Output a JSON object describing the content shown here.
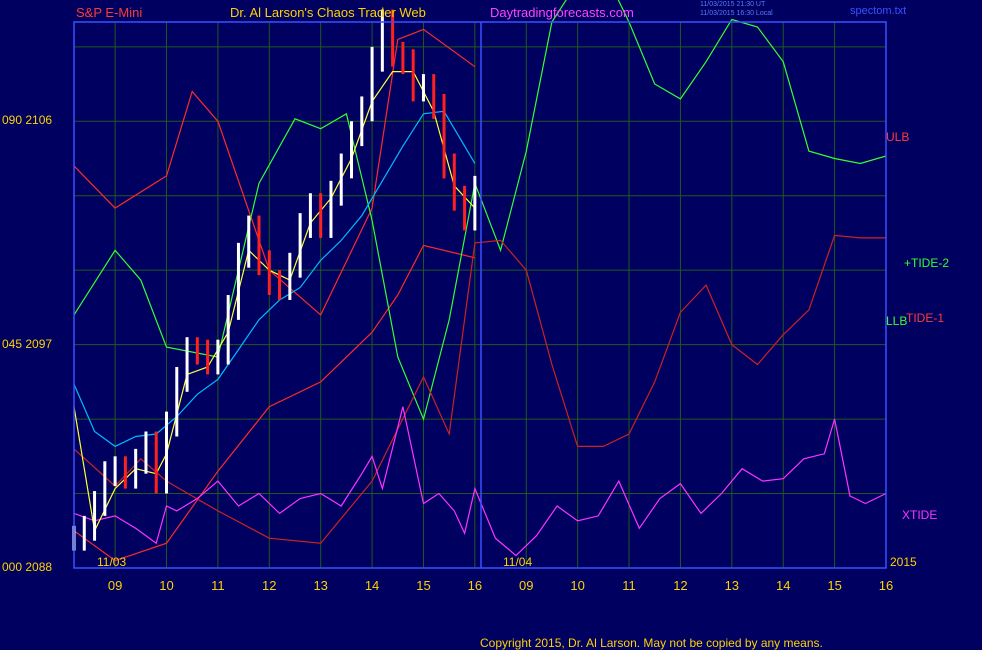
{
  "header": {
    "instrument": "S&P E-Mini",
    "title": "Dr. Al Larson's Chaos Trader Web",
    "site": "Daytradingforecasts.com",
    "stamp_utc": "11/03/2015 21:30 UT",
    "stamp_local": "11/03/2015 16:30 Local",
    "file": "spectom.txt"
  },
  "colors": {
    "background": "#000060",
    "frame": "#3a50ff",
    "grid": "#1e5a1e",
    "price_up": "#ffffff",
    "price_down": "#ff2020",
    "ulb_llb": "#ff2a2a",
    "tide2": "#33ff33",
    "tide1": "#cc2222",
    "xtide": "#ff33ff",
    "ma_fast": "#ffff33",
    "ma_slow": "#00bbff",
    "labels": "#ffd200"
  },
  "footer": {
    "copyright": "Copyright 2015, Dr. Al Larson. May not be copied by any means."
  },
  "chart_data": {
    "type": "line",
    "title": "S&P E-Mini",
    "ylim": [
      2088,
      2110
    ],
    "y_ticks": [
      {
        "left": "090",
        "value": 2106
      },
      {
        "left": "045",
        "value": 2097
      },
      {
        "left": "000",
        "value": 2088
      }
    ],
    "x_range_hours": [
      8.2,
      24
    ],
    "x_ticks": [
      {
        "label": "09",
        "hour": 9
      },
      {
        "label": "10",
        "hour": 10
      },
      {
        "label": "11",
        "hour": 11
      },
      {
        "label": "12",
        "hour": 12
      },
      {
        "label": "13",
        "hour": 13
      },
      {
        "label": "14",
        "hour": 14
      },
      {
        "label": "15",
        "hour": 15
      },
      {
        "label": "16",
        "hour": 16
      },
      {
        "label": "09",
        "hour": 17
      },
      {
        "label": "10",
        "hour": 18
      },
      {
        "label": "11",
        "hour": 19
      },
      {
        "label": "12",
        "hour": 20
      },
      {
        "label": "13",
        "hour": 21
      },
      {
        "label": "14",
        "hour": 22
      },
      {
        "label": "15",
        "hour": 23
      },
      {
        "label": "16",
        "hour": 24
      }
    ],
    "date_labels": [
      "11/03",
      "11/04"
    ],
    "date_divider_hour": 16,
    "year_label": "2015",
    "line_labels": {
      "ulb": "ULB",
      "tide2": "+TIDE-2",
      "llb": "LLB",
      "tide1": "TIDE-1",
      "xtide": "XTIDE"
    },
    "price": {
      "name": "S&P E-Mini",
      "hours": [
        8.2,
        8.4,
        8.6,
        8.8,
        9.0,
        9.2,
        9.4,
        9.6,
        9.8,
        10.0,
        10.2,
        10.4,
        10.6,
        10.8,
        11.0,
        11.2,
        11.4,
        11.6,
        11.8,
        12.0,
        12.2,
        12.4,
        12.6,
        12.8,
        13.0,
        13.2,
        13.4,
        13.6,
        13.8,
        14.0,
        14.2,
        14.4,
        14.6,
        14.8,
        15.0,
        15.2,
        15.4,
        15.6,
        15.8,
        16.0
      ],
      "values": [
        2089.2,
        2089.6,
        2090.6,
        2091.8,
        2092.0,
        2091.7,
        2092.3,
        2093.0,
        2091.5,
        2093.8,
        2095.6,
        2096.8,
        2096.7,
        2096.3,
        2096.7,
        2098.5,
        2100.6,
        2101.7,
        2100.3,
        2099.5,
        2099.3,
        2100.2,
        2101.8,
        2102.6,
        2101.8,
        2103.1,
        2104.2,
        2105.5,
        2106.5,
        2108.5,
        2110.0,
        2108.7,
        2108.4,
        2107.3,
        2107.4,
        2106.6,
        2104.2,
        2102.9,
        2102.1,
        2103.3
      ]
    },
    "series": [
      {
        "name": "ULB",
        "hours": [
          8.2,
          9.0,
          10.0,
          10.5,
          11.0,
          12.0,
          13.0,
          14.0,
          14.5,
          15.0,
          16.0
        ],
        "values": [
          2104.2,
          2102.5,
          2103.8,
          2107.2,
          2106.0,
          2100.0,
          2098.2,
          2102.5,
          2109.3,
          2109.7,
          2108.2
        ]
      },
      {
        "name": "LLB",
        "hours": [
          8.2,
          9.0,
          10.0,
          11.0,
          12.0,
          13.0,
          14.0,
          14.5,
          15.0,
          16.0
        ],
        "values": [
          2089.5,
          2088.3,
          2089.0,
          2091.9,
          2094.5,
          2095.5,
          2097.5,
          2099.0,
          2101.0,
          2100.5
        ]
      },
      {
        "name": "+TIDE-2",
        "hours": [
          8.2,
          9.0,
          9.5,
          10.0,
          11.0,
          11.8,
          12.5,
          13.0,
          13.5,
          14.0,
          14.5,
          15.0,
          15.5,
          16.0,
          16.5,
          17.0,
          17.5,
          18.0,
          18.6,
          19.0,
          19.5,
          20.0,
          20.5,
          21.0,
          21.5,
          22.0,
          22.5,
          23.0,
          23.5,
          24.0
        ],
        "values": [
          2098.2,
          2100.8,
          2099.6,
          2096.9,
          2096.5,
          2103.5,
          2106.1,
          2105.7,
          2106.3,
          2102.0,
          2096.5,
          2094.0,
          2098.0,
          2103.5,
          2100.8,
          2104.8,
          2110.0,
          2111.6,
          2111.7,
          2110.0,
          2107.5,
          2106.9,
          2108.4,
          2110.1,
          2109.8,
          2108.4,
          2104.8,
          2104.5,
          2104.3,
          2104.6
        ]
      },
      {
        "name": "TIDE-1",
        "hours": [
          8.2,
          9.0,
          9.5,
          10.0,
          11.0,
          12.0,
          13.0,
          14.0,
          14.5,
          15.0,
          15.5,
          16.0,
          16.5,
          17.0,
          17.5,
          18.0,
          18.5,
          19.0,
          19.5,
          20.0,
          20.5,
          21.0,
          21.5,
          22.0,
          22.5,
          23.0,
          23.5,
          24.0
        ],
        "values": [
          2092.8,
          2091.3,
          2092.4,
          2091.5,
          2090.3,
          2089.2,
          2089.0,
          2091.5,
          2093.6,
          2095.7,
          2093.4,
          2101.1,
          2101.2,
          2100.0,
          2096.2,
          2092.9,
          2092.9,
          2093.4,
          2095.5,
          2098.3,
          2099.4,
          2097.0,
          2096.2,
          2097.4,
          2098.4,
          2101.4,
          2101.3,
          2101.3
        ]
      },
      {
        "name": "XTIDE",
        "hours": [
          8.2,
          8.6,
          9.0,
          9.4,
          9.8,
          10.0,
          10.2,
          10.6,
          11.0,
          11.4,
          11.8,
          12.2,
          12.6,
          13.0,
          13.4,
          13.8,
          14.0,
          14.2,
          14.6,
          15.0,
          15.3,
          15.6,
          15.8,
          16.0,
          16.4,
          16.8,
          17.2,
          17.6,
          18.0,
          18.4,
          18.8,
          19.2,
          19.6,
          20.0,
          20.4,
          20.8,
          21.2,
          21.6,
          22.0,
          22.4,
          22.8,
          23.0,
          23.3,
          23.6,
          24.0
        ],
        "values": [
          2090.2,
          2089.9,
          2090.1,
          2089.6,
          2089.0,
          2090.5,
          2090.3,
          2090.8,
          2091.5,
          2090.5,
          2091.0,
          2090.2,
          2090.8,
          2091.0,
          2090.5,
          2091.8,
          2092.5,
          2091.2,
          2094.5,
          2090.6,
          2091.0,
          2090.3,
          2089.4,
          2091.2,
          2089.2,
          2088.5,
          2089.3,
          2090.5,
          2089.9,
          2090.1,
          2091.5,
          2089.6,
          2090.8,
          2091.4,
          2090.2,
          2091.0,
          2092.0,
          2091.5,
          2091.6,
          2092.4,
          2092.6,
          2094.0,
          2090.9,
          2090.6,
          2091.0
        ]
      },
      {
        "name": "fast average",
        "hours": [
          8.2,
          8.6,
          9.0,
          9.4,
          9.8,
          10.0,
          10.4,
          10.8,
          11.2,
          11.6,
          12.0,
          12.4,
          12.8,
          13.2,
          13.6,
          14.0,
          14.4,
          14.8,
          15.2,
          15.6,
          16.0
        ],
        "values": [
          2094.5,
          2089.5,
          2091.2,
          2092.0,
          2091.8,
          2092.6,
          2095.8,
          2096.1,
          2097.5,
          2100.8,
          2100.0,
          2099.6,
          2101.9,
          2102.9,
          2104.5,
          2106.8,
          2108.0,
          2108.0,
          2106.4,
          2103.4,
          2102.5
        ]
      },
      {
        "name": "slow average",
        "hours": [
          8.2,
          8.6,
          9.0,
          9.4,
          9.8,
          10.2,
          10.6,
          11.0,
          11.4,
          11.8,
          12.2,
          12.6,
          13.0,
          13.4,
          13.8,
          14.2,
          14.6,
          15.0,
          15.4,
          15.8,
          16.0
        ],
        "values": [
          2095.4,
          2093.5,
          2092.9,
          2093.3,
          2093.4,
          2094.1,
          2095.0,
          2095.6,
          2096.8,
          2098.0,
          2098.8,
          2099.3,
          2100.4,
          2101.2,
          2102.2,
          2103.6,
          2105.0,
          2106.3,
          2106.4,
          2105.0,
          2104.3
        ]
      }
    ]
  }
}
